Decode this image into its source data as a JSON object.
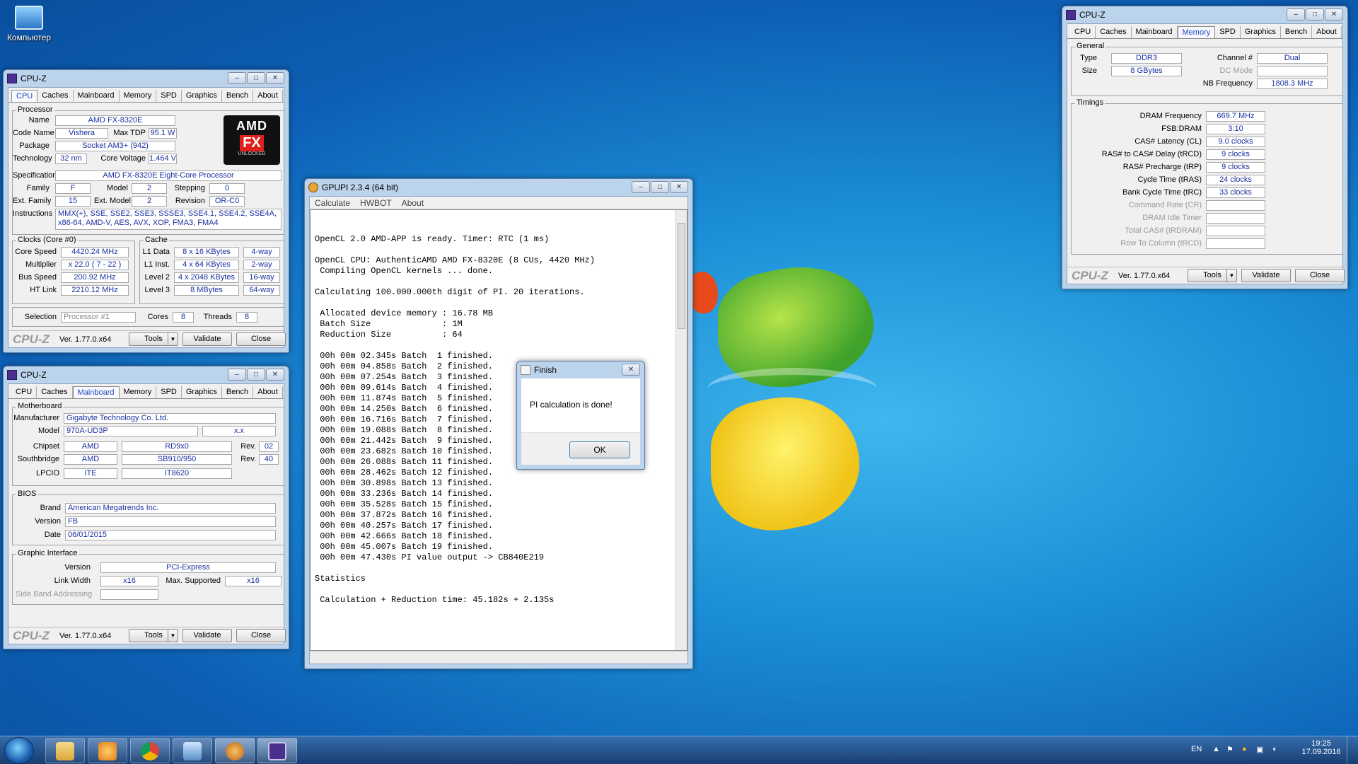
{
  "desktop": {
    "computer_icon_label": "Компьютер"
  },
  "cpuz_common": {
    "title": "CPU-Z",
    "tabs": [
      "CPU",
      "Caches",
      "Mainboard",
      "Memory",
      "SPD",
      "Graphics",
      "Bench",
      "About"
    ],
    "brand": "CPU-Z",
    "version": "Ver. 1.77.0.x64",
    "tools": "Tools",
    "validate": "Validate",
    "close": "Close"
  },
  "cpu_tab": {
    "processor_title": "Processor",
    "name_label": "Name",
    "name": "AMD FX-8320E",
    "codename_label": "Code Name",
    "codename": "Vishera",
    "maxtdp_label": "Max TDP",
    "maxtdp": "95.1 W",
    "package_label": "Package",
    "package": "Socket AM3+ (942)",
    "technology_label": "Technology",
    "technology": "32 nm",
    "corevoltage_label": "Core Voltage",
    "corevoltage": "1.464 V",
    "spec_label": "Specification",
    "spec": "AMD FX-8320E Eight-Core Processor",
    "family_label": "Family",
    "family": "F",
    "model_label": "Model",
    "model": "2",
    "stepping_label": "Stepping",
    "stepping": "0",
    "extfamily_label": "Ext. Family",
    "extfamily": "15",
    "extmodel_label": "Ext. Model",
    "extmodel": "2",
    "revision_label": "Revision",
    "revision": "OR-C0",
    "instructions_label": "Instructions",
    "instructions_line1": "MMX(+), SSE, SSE2, SSE3, SSSE3, SSE4.1, SSE4.2, SSE4A,",
    "instructions_line2": "x86-64, AMD-V, AES, AVX, XOP, FMA3, FMA4",
    "logo": {
      "amd": "AMD",
      "fx": "FX",
      "unlocked": "UNLOCKED"
    },
    "clocks_title": "Clocks (Core #0)",
    "corespeed_label": "Core Speed",
    "corespeed": "4420.24 MHz",
    "multiplier_label": "Multiplier",
    "multiplier": "x 22.0 ( 7 - 22 )",
    "busspeed_label": "Bus Speed",
    "busspeed": "200.92 MHz",
    "htlink_label": "HT Link",
    "htlink": "2210.12 MHz",
    "cache_title": "Cache",
    "l1data_label": "L1 Data",
    "l1data": "8 x 16 KBytes",
    "l1data_way": "4-way",
    "l1inst_label": "L1 Inst.",
    "l1inst": "4 x 64 KBytes",
    "l1inst_way": "2-way",
    "level2_label": "Level 2",
    "level2": "4 x 2048 KBytes",
    "level2_way": "16-way",
    "level3_label": "Level 3",
    "level3": "8 MBytes",
    "level3_way": "64-way",
    "selection_label": "Selection",
    "selection": "Processor #1",
    "cores_label": "Cores",
    "cores": "8",
    "threads_label": "Threads",
    "threads": "8"
  },
  "mainboard_tab": {
    "motherboard_title": "Motherboard",
    "manufacturer_label": "Manufacturer",
    "manufacturer": "Gigabyte Technology Co. Ltd.",
    "model_label": "Model",
    "model": "970A-UD3P",
    "model_rev": "x.x",
    "chipset_label": "Chipset",
    "chipset_vendor": "AMD",
    "chipset_name": "RD9x0",
    "chipset_rev_label": "Rev.",
    "chipset_rev": "02",
    "southbridge_label": "Southbridge",
    "southbridge_vendor": "AMD",
    "southbridge_name": "SB910/950",
    "southbridge_rev_label": "Rev.",
    "southbridge_rev": "40",
    "lpcio_label": "LPCIO",
    "lpcio_vendor": "ITE",
    "lpcio_name": "IT8620",
    "bios_title": "BIOS",
    "brand_label": "Brand",
    "brand": "American Megatrends Inc.",
    "version_label": "Version",
    "version": "FB",
    "date_label": "Date",
    "date": "06/01/2015",
    "graphic_title": "Graphic Interface",
    "gi_version_label": "Version",
    "gi_version": "PCI-Express",
    "linkwidth_label": "Link Width",
    "linkwidth": "x16",
    "maxsupported_label": "Max. Supported",
    "maxsupported": "x16",
    "sideband_label": "Side Band Addressing",
    "sideband": ""
  },
  "memory_tab": {
    "general_title": "General",
    "type_label": "Type",
    "type": "DDR3",
    "size_label": "Size",
    "size": "8 GBytes",
    "channel_label": "Channel #",
    "channel": "Dual",
    "dcmode_label": "DC Mode",
    "dcmode": "",
    "nbfreq_label": "NB Frequency",
    "nbfreq": "1808.3 MHz",
    "timings_title": "Timings",
    "timings": [
      {
        "label": "DRAM Frequency",
        "value": "669.7 MHz"
      },
      {
        "label": "FSB:DRAM",
        "value": "3:10"
      },
      {
        "label": "CAS# Latency (CL)",
        "value": "9.0 clocks"
      },
      {
        "label": "RAS# to CAS# Delay (tRCD)",
        "value": "9 clocks"
      },
      {
        "label": "RAS# Precharge (tRP)",
        "value": "9 clocks"
      },
      {
        "label": "Cycle Time (tRAS)",
        "value": "24 clocks"
      },
      {
        "label": "Bank Cycle Time (tRC)",
        "value": "33 clocks"
      }
    ],
    "timings_disabled": [
      {
        "label": "Command Rate (CR)",
        "value": ""
      },
      {
        "label": "DRAM Idle Timer",
        "value": ""
      },
      {
        "label": "Total CAS# (tRDRAM)",
        "value": ""
      },
      {
        "label": "Row To Column (tRCD)",
        "value": ""
      }
    ]
  },
  "gpupi": {
    "title": "GPUPI 2.3.4 (64 bit)",
    "menu": [
      "Calculate",
      "HWBOT",
      "About"
    ],
    "lines": [
      "OpenCL 2.0 AMD-APP is ready. Timer: RTC (1 ms)",
      "",
      "OpenCL CPU: AuthenticAMD AMD FX-8320E (8 CUs, 4420 MHz)",
      " Compiling OpenCL kernels ... done.",
      "",
      "Calculating 100.000.000th digit of PI. 20 iterations.",
      "",
      " Allocated device memory : 16.78 MB",
      " Batch Size              : 1M",
      " Reduction Size          : 64",
      "",
      " 00h 00m 02.345s Batch  1 finished.",
      " 00h 00m 04.858s Batch  2 finished.",
      " 00h 00m 07.254s Batch  3 finished.",
      " 00h 00m 09.614s Batch  4 finished.",
      " 00h 00m 11.874s Batch  5 finished.",
      " 00h 00m 14.250s Batch  6 finished.",
      " 00h 00m 16.716s Batch  7 finished.",
      " 00h 00m 19.088s Batch  8 finished.",
      " 00h 00m 21.442s Batch  9 finished.",
      " 00h 00m 23.682s Batch 10 finished.",
      " 00h 00m 26.088s Batch 11 finished.",
      " 00h 00m 28.462s Batch 12 finished.",
      " 00h 00m 30.898s Batch 13 finished.",
      " 00h 00m 33.236s Batch 14 finished.",
      " 00h 00m 35.528s Batch 15 finished.",
      " 00h 00m 37.872s Batch 16 finished.",
      " 00h 00m 40.257s Batch 17 finished.",
      " 00h 00m 42.666s Batch 18 finished.",
      " 00h 00m 45.007s Batch 19 finished.",
      " 00h 00m 47.430s PI value output -> CB840E219",
      "",
      "Statistics",
      "",
      " Calculation + Reduction time: 45.182s + 2.135s"
    ]
  },
  "dialog": {
    "title": "Finish",
    "message": "PI calculation is done!",
    "ok": "OK"
  },
  "taskbar": {
    "lang": "EN",
    "time": "19:25",
    "date": "17.09.2016",
    "apps": [
      "explorer-icon",
      "media-player-icon",
      "chrome-icon",
      "image-viewer-icon",
      "gpupi-icon",
      "cpuz-icon"
    ]
  }
}
